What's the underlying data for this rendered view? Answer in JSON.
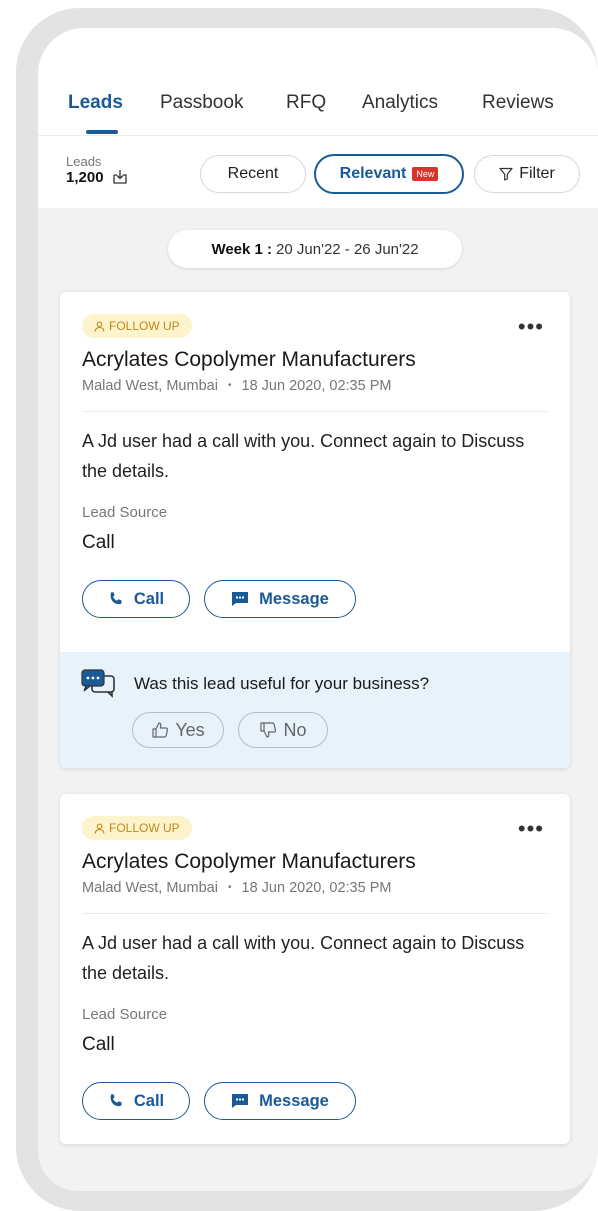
{
  "tabs": [
    {
      "label": "Leads",
      "active": true
    },
    {
      "label": "Passbook",
      "active": false
    },
    {
      "label": "RFQ",
      "active": false
    },
    {
      "label": "Analytics",
      "active": false
    },
    {
      "label": "Reviews",
      "active": false
    }
  ],
  "leads_summary": {
    "label": "Leads",
    "count": "1,200",
    "icon": "download-icon"
  },
  "filters": {
    "recent": "Recent",
    "relevant": "Relevant",
    "new_badge": "New",
    "filter": "Filter"
  },
  "week": {
    "prefix": "Week 1 :",
    "range": "20 Jun'22 - 26 Jun'22"
  },
  "cards": [
    {
      "badge": "FOLLOW UP",
      "title": "Acrylates Copolymer Manufacturers",
      "location": "Malad West, Mumbai",
      "separator": "•",
      "timestamp": "18 Jun 2020, 02:35 PM",
      "description": "A Jd user had a call with you. Connect again to Discuss the details.",
      "lead_source_label": "Lead Source",
      "lead_source_value": "Call",
      "call_label": "Call",
      "message_label": "Message",
      "feedback": {
        "question": "Was this lead useful for your business?",
        "yes": "Yes",
        "no": "No"
      }
    },
    {
      "badge": "FOLLOW UP",
      "title": "Acrylates Copolymer Manufacturers",
      "location": "Malad West, Mumbai",
      "separator": "•",
      "timestamp": "18 Jun 2020, 02:35 PM",
      "description": "A Jd user had a call with you. Connect again to Discuss the details.",
      "lead_source_label": "Lead Source",
      "lead_source_value": "Call",
      "call_label": "Call",
      "message_label": "Message"
    }
  ],
  "colors": {
    "accent": "#1a5a96",
    "badge_bg": "#fdf3cc",
    "badge_text": "#c08a16",
    "new_badge": "#d9342b",
    "feedback_bg": "#e8f2fb"
  }
}
